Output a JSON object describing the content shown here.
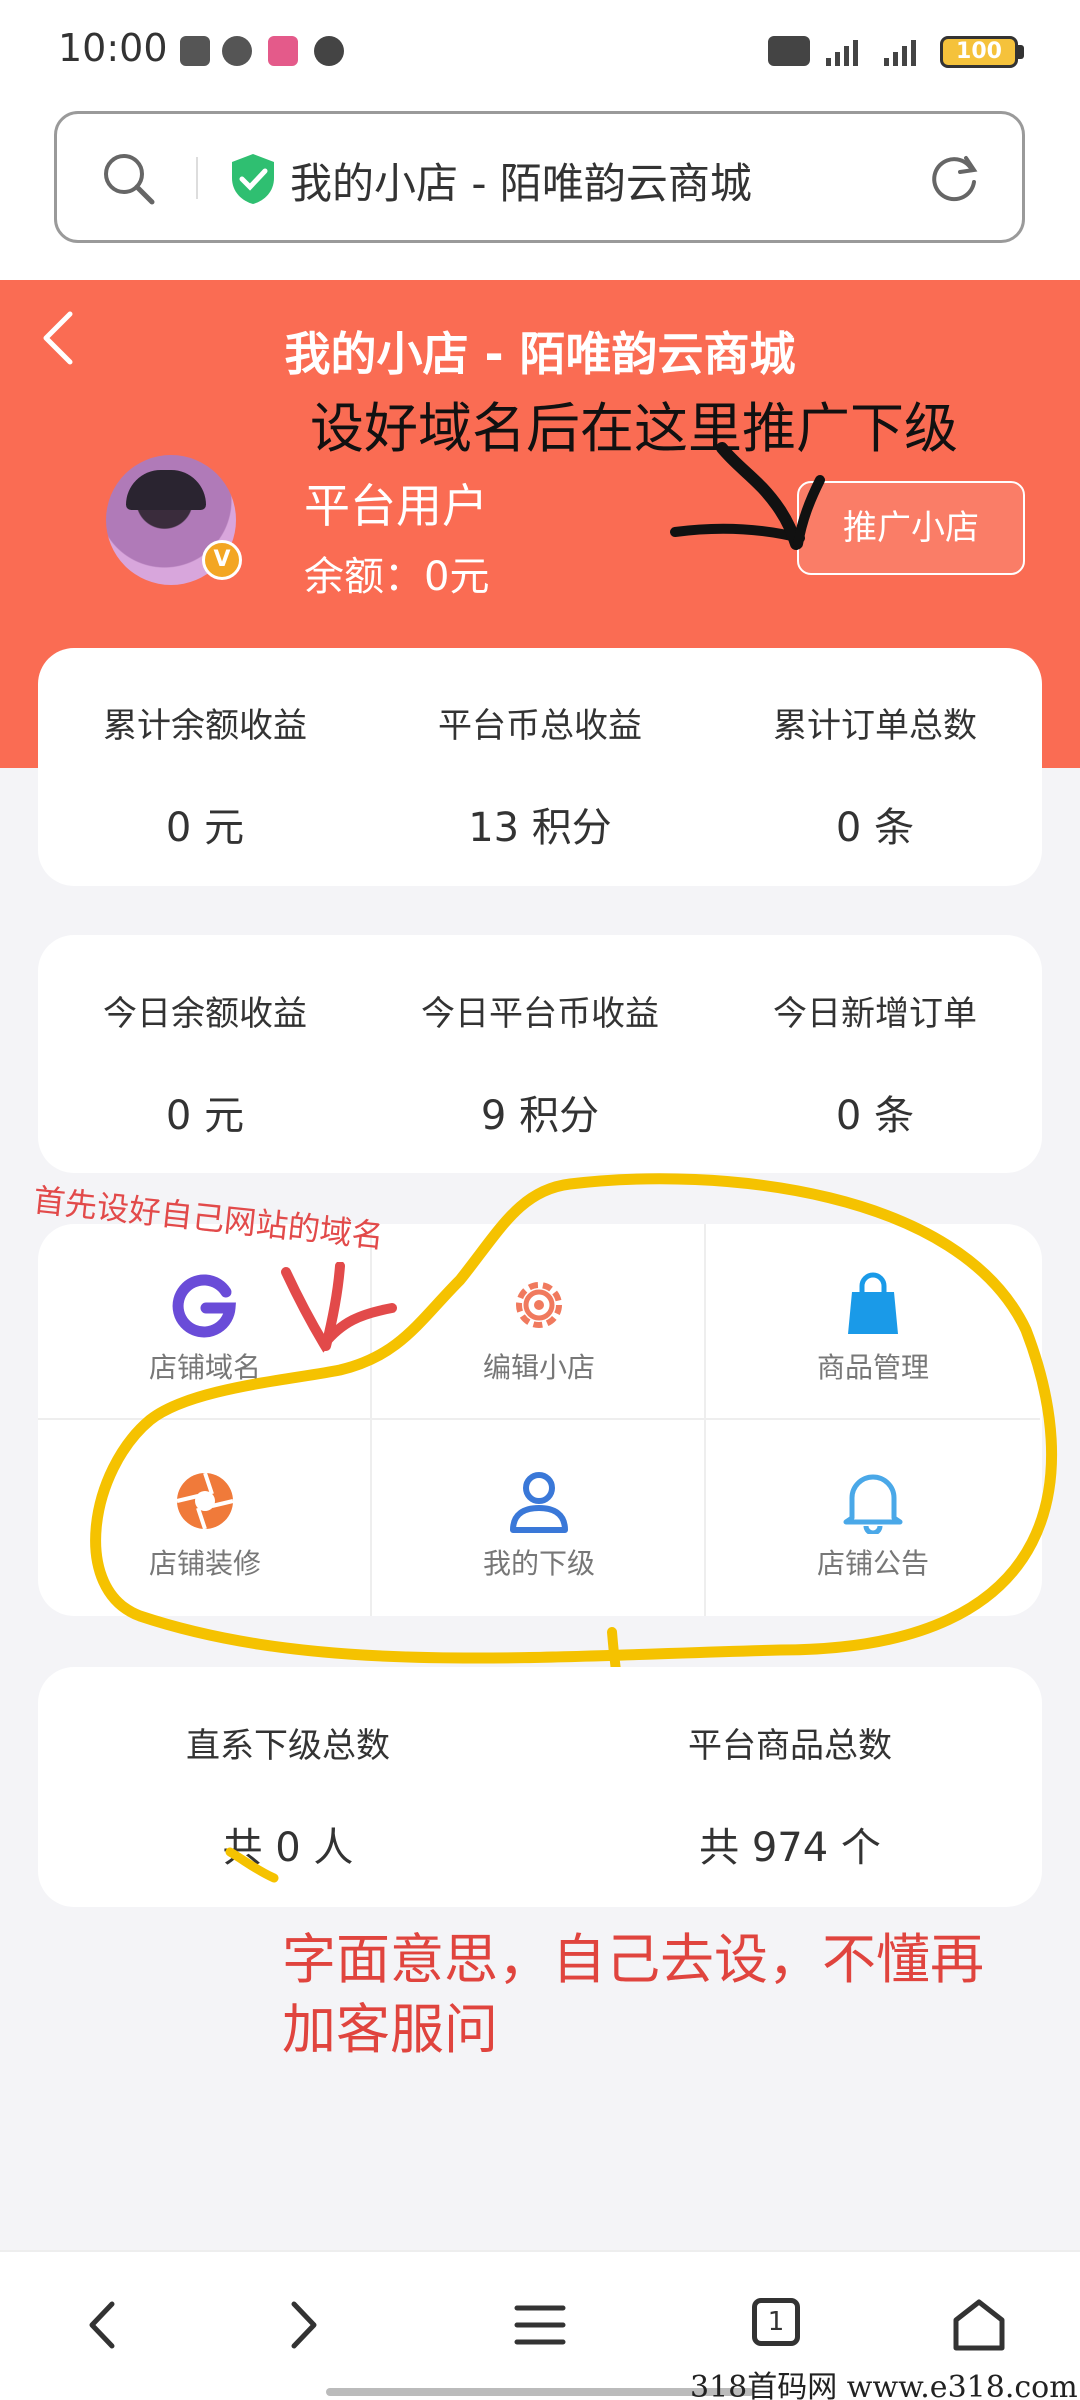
{
  "status_bar": {
    "time": "10:00",
    "icons": [
      "clipboard-icon",
      "wechat-icon",
      "app-icon",
      "speed-icon",
      "hd-icon",
      "signal-4g-icon",
      "signal-4g-icon"
    ],
    "battery": "100"
  },
  "browser": {
    "address_text": "我的小店 - 陌唯韵云商城",
    "icons": [
      "search-icon",
      "shield-check-icon",
      "reload-icon"
    ]
  },
  "header": {
    "title": "我的小店 - 陌唯韵云商城",
    "user_name": "平台用户",
    "balance": "余额：0元",
    "vip_badge": "V",
    "promote_button": "推广小店"
  },
  "totals": [
    {
      "label": "累计余额收益",
      "value": "0 元"
    },
    {
      "label": "平台币总收益",
      "value": "13 积分"
    },
    {
      "label": "累计订单总数",
      "value": "0 条"
    }
  ],
  "today": [
    {
      "label": "今日余额收益",
      "value": "0 元"
    },
    {
      "label": "今日平台币收益",
      "value": "9 积分"
    },
    {
      "label": "今日新增订单",
      "value": "0 条"
    }
  ],
  "menu": [
    {
      "label": "店铺域名",
      "icon": "google-g-icon",
      "color": "#6a4cd8"
    },
    {
      "label": "编辑小店",
      "icon": "gear-icon",
      "color": "#f07a5e"
    },
    {
      "label": "商品管理",
      "icon": "shopping-bag-icon",
      "color": "#1a9ae8"
    },
    {
      "label": "店铺装修",
      "icon": "aperture-icon",
      "color": "#f07a3a"
    },
    {
      "label": "我的下级",
      "icon": "user-icon",
      "color": "#3a78d8"
    },
    {
      "label": "店铺公告",
      "icon": "bell-icon",
      "color": "#4aa8e8"
    }
  ],
  "summary": [
    {
      "label": "直系下级总数",
      "value": "共 0 人"
    },
    {
      "label": "平台商品总数",
      "value": "共 974 个"
    }
  ],
  "annotations": {
    "top": "设好域名后在这里推广下级",
    "left": "首先设好自己网站的域名",
    "bottom": "字面意思，自己去设，不懂再加客服问"
  },
  "bottom_nav": {
    "tab_count": "1",
    "icons": [
      "back-arrow-icon",
      "forward-arrow-icon",
      "menu-icon",
      "tabs-icon",
      "home-icon"
    ]
  },
  "watermark": "318首码网 www.e318.com"
}
